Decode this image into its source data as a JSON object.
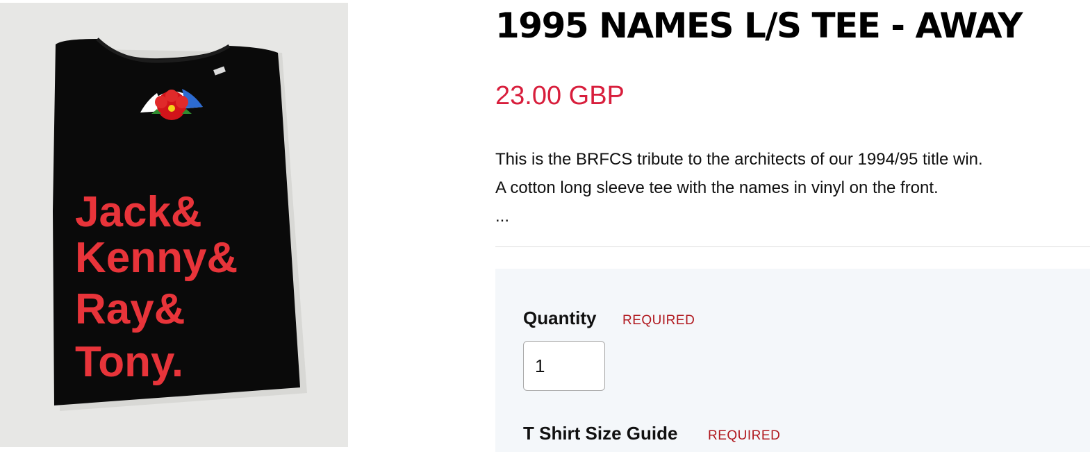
{
  "product": {
    "title": "1995 NAMES L/S TEE - AWAY",
    "price": "23.00 GBP",
    "description": [
      "This is the BRFCS tribute to the architects of our 1994/95 title win.",
      "A cotton long sleeve tee with the names in vinyl on the front.",
      "..."
    ]
  },
  "image": {
    "shirt_names": [
      "Jack&",
      "Kenny&",
      "Ray&",
      "Tony."
    ],
    "shirt_color": "#0a0a0a",
    "print_color": "#e8343a",
    "background_color": "#e7e7e5"
  },
  "form": {
    "quantity": {
      "label": "Quantity",
      "required_text": "REQUIRED",
      "value": "1"
    },
    "size_guide": {
      "label": "T Shirt Size Guide",
      "required_text": "REQUIRED"
    }
  },
  "colors": {
    "price": "#d81e3c",
    "required": "#b0171d",
    "panel_bg": "#f4f7fa"
  }
}
